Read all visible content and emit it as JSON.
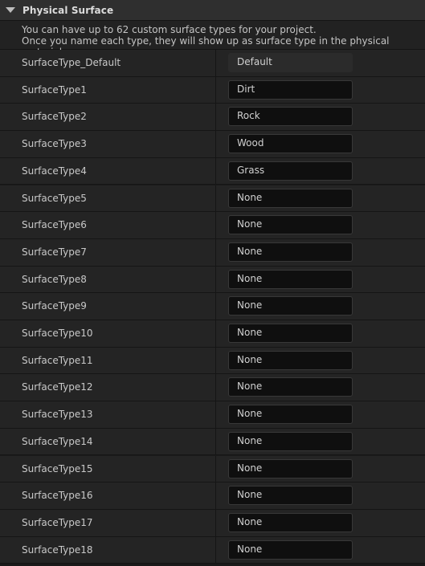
{
  "section": {
    "title": "Physical Surface",
    "description_line1": "You can have up to 62 custom surface types for your project.",
    "description_line2": "Once you name each type, they will show up as surface type in the physical material."
  },
  "rows": [
    {
      "label": "SurfaceType_Default",
      "value": "Default",
      "readonly": true
    },
    {
      "label": "SurfaceType1",
      "value": "Dirt"
    },
    {
      "label": "SurfaceType2",
      "value": "Rock"
    },
    {
      "label": "SurfaceType3",
      "value": "Wood"
    },
    {
      "label": "SurfaceType4",
      "value": "Grass"
    },
    {
      "label": "SurfaceType5",
      "value": "None"
    },
    {
      "label": "SurfaceType6",
      "value": "None"
    },
    {
      "label": "SurfaceType7",
      "value": "None"
    },
    {
      "label": "SurfaceType8",
      "value": "None"
    },
    {
      "label": "SurfaceType9",
      "value": "None"
    },
    {
      "label": "SurfaceType10",
      "value": "None"
    },
    {
      "label": "SurfaceType11",
      "value": "None"
    },
    {
      "label": "SurfaceType12",
      "value": "None"
    },
    {
      "label": "SurfaceType13",
      "value": "None"
    },
    {
      "label": "SurfaceType14",
      "value": "None"
    },
    {
      "label": "SurfaceType15",
      "value": "None"
    },
    {
      "label": "SurfaceType16",
      "value": "None"
    },
    {
      "label": "SurfaceType17",
      "value": "None"
    },
    {
      "label": "SurfaceType18",
      "value": "None"
    }
  ]
}
